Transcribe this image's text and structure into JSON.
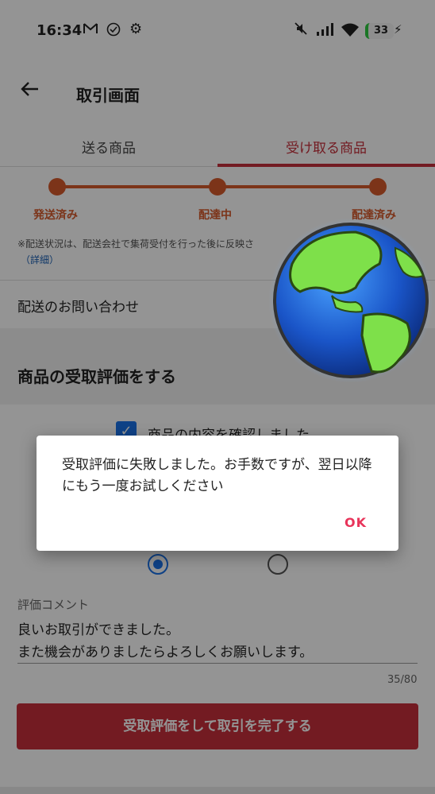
{
  "status_bar": {
    "time": "16:34",
    "battery": "33",
    "battery_color": "#2ecc40"
  },
  "app_bar": {
    "title": "取引画面",
    "back_icon": "arrow-back-icon"
  },
  "tabs": [
    {
      "label": "送る商品",
      "selected": false
    },
    {
      "label": "受け取る商品",
      "selected": true
    }
  ],
  "progress": {
    "steps": [
      "発送済み",
      "配達中",
      "配達済み"
    ],
    "color": "#d65a2c"
  },
  "notice": {
    "text": "※配送状況は、配送会社で集荷受付を行った後に反映さ",
    "link": "（詳細）"
  },
  "delivery_inquiry": "配送のお問い合わせ",
  "rating_section": {
    "title": "商品の受取評価をする",
    "confirm_label": "商品の内容を確認しました",
    "confirm_checked": true,
    "comment_label": "評価コメント",
    "comment_lines": [
      "良いお取引ができました。",
      "また機会がありましたらよろしくお願いします。"
    ],
    "counter": "35/80"
  },
  "submit_label": "受取評価をして取引を完了する",
  "dialog": {
    "message": "受取評価に失敗しました。お手数ですが、翌日以降にもう一度お試しください",
    "ok": "OK"
  },
  "colors": {
    "accent": "#c6303b",
    "ok_text": "#e8345a",
    "checkbox": "#1a73e8"
  }
}
